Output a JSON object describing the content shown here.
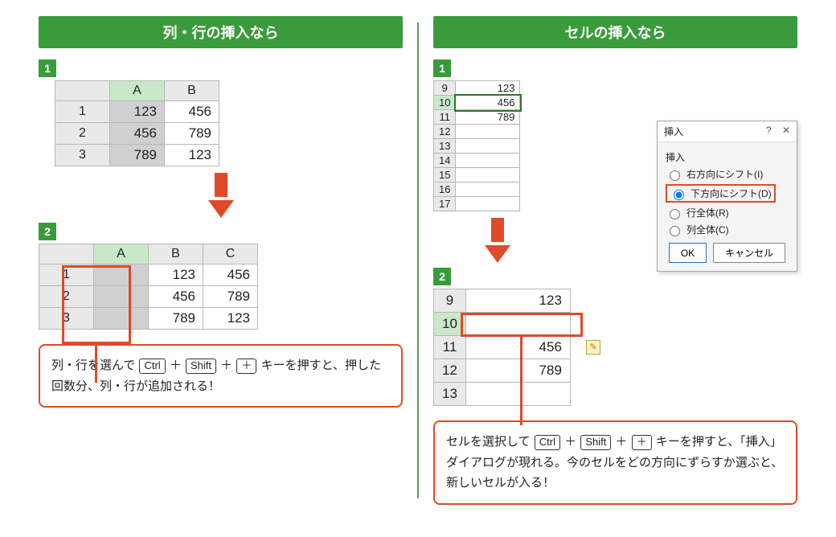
{
  "left": {
    "heading": "列・行の挿入なら",
    "step1": {
      "num": "1",
      "cols": [
        "A",
        "B"
      ],
      "rows": [
        {
          "n": "1",
          "a": "123",
          "b": "456"
        },
        {
          "n": "2",
          "a": "456",
          "b": "789"
        },
        {
          "n": "3",
          "a": "789",
          "b": "123"
        }
      ]
    },
    "step2": {
      "num": "2",
      "cols": [
        "A",
        "B",
        "C"
      ],
      "rows": [
        {
          "n": "1",
          "a": "",
          "b": "123",
          "c": "456"
        },
        {
          "n": "2",
          "a": "",
          "b": "456",
          "c": "789"
        },
        {
          "n": "3",
          "a": "",
          "b": "789",
          "c": "123"
        }
      ]
    },
    "callout": {
      "t1": "列・行を選んで",
      "k1": "Ctrl",
      "plus1": "＋",
      "k2": "Shift",
      "plus2": "＋",
      "k3": "＋",
      "t2": "キーを押すと、押した回数分、列・行が追加される！"
    }
  },
  "right": {
    "heading": "セルの挿入なら",
    "step1": {
      "num": "1",
      "rows": [
        {
          "n": "9",
          "v": "123"
        },
        {
          "n": "10",
          "v": "456"
        },
        {
          "n": "11",
          "v": "789"
        },
        {
          "n": "12",
          "v": ""
        },
        {
          "n": "13",
          "v": ""
        },
        {
          "n": "14",
          "v": ""
        },
        {
          "n": "15",
          "v": ""
        },
        {
          "n": "16",
          "v": ""
        },
        {
          "n": "17",
          "v": ""
        }
      ]
    },
    "dialog": {
      "title": "挿入",
      "help": "?",
      "close": "✕",
      "grp": "挿入",
      "opt1": "右方向にシフト(I)",
      "opt2": "下方向にシフト(D)",
      "opt3": "行全体(R)",
      "opt4": "列全体(C)",
      "ok": "OK",
      "cancel": "キャンセル"
    },
    "step2": {
      "num": "2",
      "rows": [
        {
          "n": "9",
          "v": "123"
        },
        {
          "n": "10",
          "v": ""
        },
        {
          "n": "11",
          "v": "456"
        },
        {
          "n": "12",
          "v": "789"
        },
        {
          "n": "13",
          "v": ""
        }
      ]
    },
    "callout": {
      "t1": "セルを選択して",
      "k1": "Ctrl",
      "plus1": "＋",
      "k2": "Shift",
      "plus2": "＋",
      "k3": "＋",
      "t2": "キーを押すと、「挿入」ダイアログが現れる。今のセルをどの方向にずらすか選ぶと、新しいセルが入る！"
    }
  }
}
